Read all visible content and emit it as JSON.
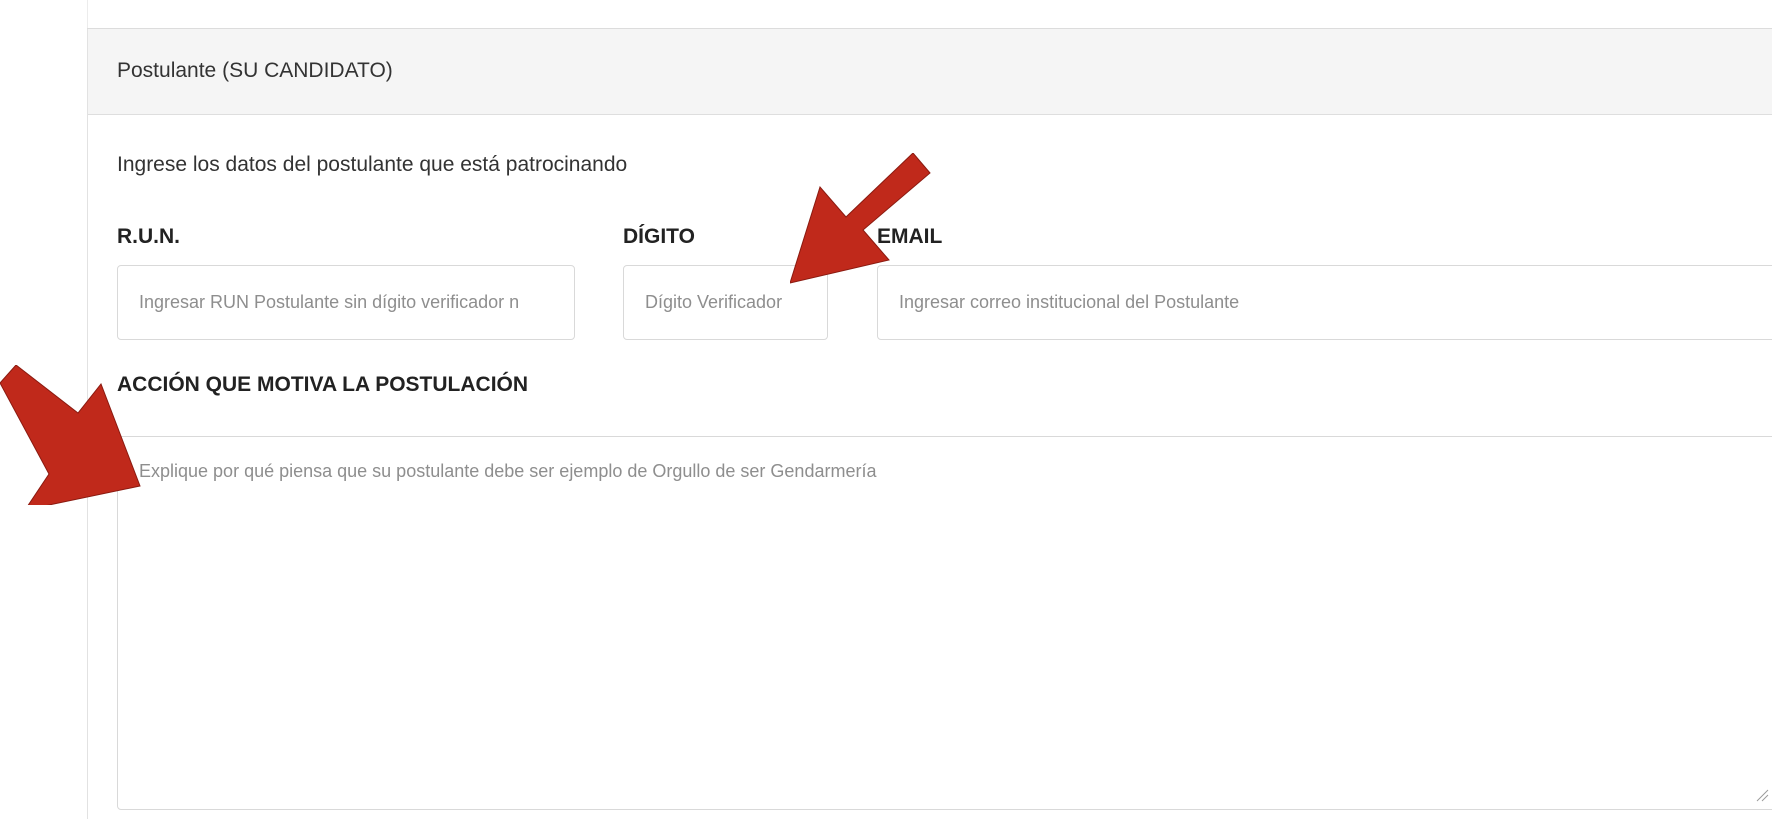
{
  "panel": {
    "title": "Postulante (SU CANDIDATO)"
  },
  "form": {
    "intro": "Ingrese los datos del postulante que está patrocinando",
    "run": {
      "label": "R.U.N.",
      "placeholder": "Ingresar RUN Postulante sin dígito verificador n"
    },
    "digito": {
      "label": "DÍGITO",
      "placeholder": "Dígito Verificador"
    },
    "email": {
      "label": "EMAIL",
      "placeholder": "Ingresar correo institucional del Postulante"
    },
    "accion": {
      "label": "ACCIÓN QUE MOTIVA LA POSTULACIÓN",
      "placeholder": "Explique por qué piensa que su postulante debe ser ejemplo de Orgullo de ser Gendarmería"
    }
  },
  "annotations": {
    "arrow_color": "#c0291b",
    "arrow_icon": "arrow-annotation-icon"
  }
}
